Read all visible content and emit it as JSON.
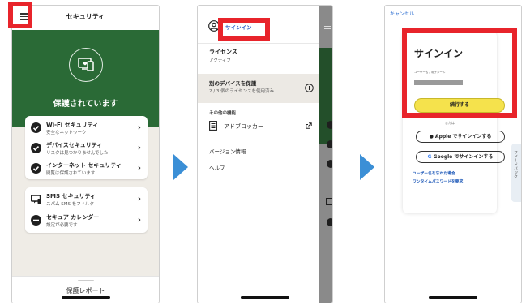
{
  "colors": {
    "accent_red": "#e8242b",
    "green": "#2a6a36",
    "arrow_blue": "#3b8fd6",
    "yellow": "#f5e24c",
    "link_blue": "#2e6fd1"
  },
  "screen1": {
    "menu_icon": "hamburger-icon",
    "title": "セキュリティ",
    "status": "保護されています",
    "card1": [
      {
        "title": "Wi-Fi セキュリティ",
        "subtitle": "安全なネットワーク",
        "icon": "check-circle-icon"
      },
      {
        "title": "デバイスセキュリティ",
        "subtitle": "リスクは見つかりませんでした",
        "icon": "check-circle-icon"
      },
      {
        "title": "インターネット セキュリティ",
        "subtitle": "閲覧は保護されています",
        "icon": "check-circle-icon"
      }
    ],
    "card2": [
      {
        "title": "SMS セキュリティ",
        "subtitle": "スパム SMS をフィルタ",
        "icon": "sms-device-icon"
      },
      {
        "title": "セキュア カレンダー",
        "subtitle": "設定が必要です",
        "icon": "minus-circle-icon"
      }
    ],
    "footer": "保護レポート"
  },
  "screen2": {
    "signin": "サインイン",
    "license_title": "ライセンス",
    "license_status": "アクティブ",
    "protect_title": "別のデバイスを保護",
    "protect_sub": "2 / 3 個のライセンスを使用済み",
    "other_features": "その他の機能",
    "adblocker": "アドブロッカー",
    "version": "バージョン情報",
    "help": "ヘルプ"
  },
  "screen3": {
    "cancel": "キャンセル",
    "title": "サインイン",
    "email_label": "ユーザー名 / 電子メール",
    "continue": "続行する",
    "or": "または",
    "apple": " Apple でサインインする",
    "google": "Google でサインインする",
    "forgot": "ユーザー名を忘れた場合",
    "otp": "ワンタイムパスワードを要求",
    "side_tab": "フィードバック"
  }
}
